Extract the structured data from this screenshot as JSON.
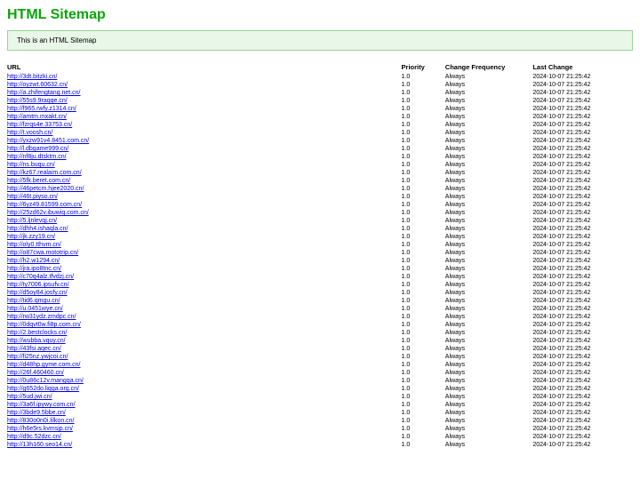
{
  "title": "HTML Sitemap",
  "info_text": "This is an HTML Sitemap",
  "headers": {
    "url": "URL",
    "priority": "Priority",
    "frequency": "Change Frequency",
    "last_change": "Last Change"
  },
  "rows": [
    {
      "url": "http://3dt.bitzki.cn/",
      "priority": "1.0",
      "freq": "Always",
      "last": "2024-10-07 21:25:42"
    },
    {
      "url": "http://oyzwt.60632.cn/",
      "priority": "1.0",
      "freq": "Always",
      "last": "2024-10-07 21:25:42"
    },
    {
      "url": "http://a.zhifengtang.net.cn/",
      "priority": "1.0",
      "freq": "Always",
      "last": "2024-10-07 21:25:42"
    },
    {
      "url": "http://55s9.9raqqe.cn/",
      "priority": "1.0",
      "freq": "Always",
      "last": "2024-10-07 21:25:42"
    },
    {
      "url": "http://f965.rwfy.z1314.cn/",
      "priority": "1.0",
      "freq": "Always",
      "last": "2024-10-07 21:25:42"
    },
    {
      "url": "http://amtm.mxakt.cn/",
      "priority": "1.0",
      "freq": "Always",
      "last": "2024-10-07 21:25:42"
    },
    {
      "url": "http://fzrqs4e.33753.cn/",
      "priority": "1.0",
      "freq": "Always",
      "last": "2024-10-07 21:25:42"
    },
    {
      "url": "http://t.voosh.cn/",
      "priority": "1.0",
      "freq": "Always",
      "last": "2024-10-07 21:25:42"
    },
    {
      "url": "http://yxzw91v4.8451.com.cn/",
      "priority": "1.0",
      "freq": "Always",
      "last": "2024-10-07 21:25:42"
    },
    {
      "url": "http://l.dbgame999.cn/",
      "priority": "1.0",
      "freq": "Always",
      "last": "2024-10-07 21:25:42"
    },
    {
      "url": "http://nf8ju.dtsktm.cn/",
      "priority": "1.0",
      "freq": "Always",
      "last": "2024-10-07 21:25:42"
    },
    {
      "url": "http://ns.buqu.cn/",
      "priority": "1.0",
      "freq": "Always",
      "last": "2024-10-07 21:25:42"
    },
    {
      "url": "http://kz67.realaim.com.cn/",
      "priority": "1.0",
      "freq": "Always",
      "last": "2024-10-07 21:25:42"
    },
    {
      "url": "http://5fk.beret.com.cn/",
      "priority": "1.0",
      "freq": "Always",
      "last": "2024-10-07 21:25:42"
    },
    {
      "url": "http://46petcm.hjee2020.cn/",
      "priority": "1.0",
      "freq": "Always",
      "last": "2024-10-07 21:25:42"
    },
    {
      "url": "http://46t.piyso.cn/",
      "priority": "1.0",
      "freq": "Always",
      "last": "2024-10-07 21:25:42"
    },
    {
      "url": "http://6yz49.81599.com.cn/",
      "priority": "1.0",
      "freq": "Always",
      "last": "2024-10-07 21:25:42"
    },
    {
      "url": "http://25zd62v.ibuwiq.com.cn/",
      "priority": "1.0",
      "freq": "Always",
      "last": "2024-10-07 21:25:42"
    },
    {
      "url": "http://5.ljnlevqj.cn/",
      "priority": "1.0",
      "freq": "Always",
      "last": "2024-10-07 21:25:42"
    },
    {
      "url": "http://dhh4.ishaqla.cn/",
      "priority": "1.0",
      "freq": "Always",
      "last": "2024-10-07 21:25:42"
    },
    {
      "url": "http://jk.zzy19.cn/",
      "priority": "1.0",
      "freq": "Always",
      "last": "2024-10-07 21:25:42"
    },
    {
      "url": "http://oly0.tthvm.cn/",
      "priority": "1.0",
      "freq": "Always",
      "last": "2024-10-07 21:25:42"
    },
    {
      "url": "http://o87cwa.mototrip.cn/",
      "priority": "1.0",
      "freq": "Always",
      "last": "2024-10-07 21:25:42"
    },
    {
      "url": "http://h2.w1294.cn/",
      "priority": "1.0",
      "freq": "Always",
      "last": "2024-10-07 21:25:42"
    },
    {
      "url": "http://jra.ipo8tnc.cn/",
      "priority": "1.0",
      "freq": "Always",
      "last": "2024-10-07 21:25:42"
    },
    {
      "url": "http://c70q4alz.tfvdzj.cn/",
      "priority": "1.0",
      "freq": "Always",
      "last": "2024-10-07 21:25:42"
    },
    {
      "url": "http://ty7006.ipsufv.cn/",
      "priority": "1.0",
      "freq": "Always",
      "last": "2024-10-07 21:25:42"
    },
    {
      "url": "http://d5oy84.josfy.cn/",
      "priority": "1.0",
      "freq": "Always",
      "last": "2024-10-07 21:25:42"
    },
    {
      "url": "http://tid6.qmgu.cn/",
      "priority": "1.0",
      "freq": "Always",
      "last": "2024-10-07 21:25:42"
    },
    {
      "url": "http://u.0451wye.cn/",
      "priority": "1.0",
      "freq": "Always",
      "last": "2024-10-07 21:25:42"
    },
    {
      "url": "http://rw31ydz.zmdpc.cn/",
      "priority": "1.0",
      "freq": "Always",
      "last": "2024-10-07 21:25:42"
    },
    {
      "url": "http://0dqvt0w.fi8p.com.cn/",
      "priority": "1.0",
      "freq": "Always",
      "last": "2024-10-07 21:25:42"
    },
    {
      "url": "http://2.bestclocks.cn/",
      "priority": "1.0",
      "freq": "Always",
      "last": "2024-10-07 21:25:42"
    },
    {
      "url": "http://wubba.vquy.cn/",
      "priority": "1.0",
      "freq": "Always",
      "last": "2024-10-07 21:25:42"
    },
    {
      "url": "http://43fsi.aqec.cn/",
      "priority": "1.0",
      "freq": "Always",
      "last": "2024-10-07 21:25:42"
    },
    {
      "url": "http://fi25nz.ywjcoi.cn/",
      "priority": "1.0",
      "freq": "Always",
      "last": "2024-10-07 21:25:42"
    },
    {
      "url": "http://d48hp.gyme.com.cn/",
      "priority": "1.0",
      "freq": "Always",
      "last": "2024-10-07 21:25:42"
    },
    {
      "url": "http://26f.460460.cn/",
      "priority": "1.0",
      "freq": "Always",
      "last": "2024-10-07 21:25:42"
    },
    {
      "url": "http://0u86c12v.mangqa.cn/",
      "priority": "1.0",
      "freq": "Always",
      "last": "2024-10-07 21:25:42"
    },
    {
      "url": "http://g652do.liqga.org.cn/",
      "priority": "1.0",
      "freq": "Always",
      "last": "2024-10-07 21:25:42"
    },
    {
      "url": "http://5ud.jwi.cn/",
      "priority": "1.0",
      "freq": "Always",
      "last": "2024-10-07 21:25:42"
    },
    {
      "url": "http://3a6f.ipywy.com.cn/",
      "priority": "1.0",
      "freq": "Always",
      "last": "2024-10-07 21:25:42"
    },
    {
      "url": "http://3bde9.5bbe.cn/",
      "priority": "1.0",
      "freq": "Always",
      "last": "2024-10-07 21:25:42"
    },
    {
      "url": "http://830o0n0i.lilkon.cn/",
      "priority": "1.0",
      "freq": "Always",
      "last": "2024-10-07 21:25:42"
    },
    {
      "url": "http://h6e5rs.kvmsjp.cn/",
      "priority": "1.0",
      "freq": "Always",
      "last": "2024-10-07 21:25:42"
    },
    {
      "url": "http://d9c.52dzc.cn/",
      "priority": "1.0",
      "freq": "Always",
      "last": "2024-10-07 21:25:42"
    },
    {
      "url": "http://13h160.seo14.cn/",
      "priority": "1.0",
      "freq": "Always",
      "last": "2024-10-07 21:25:42"
    }
  ]
}
